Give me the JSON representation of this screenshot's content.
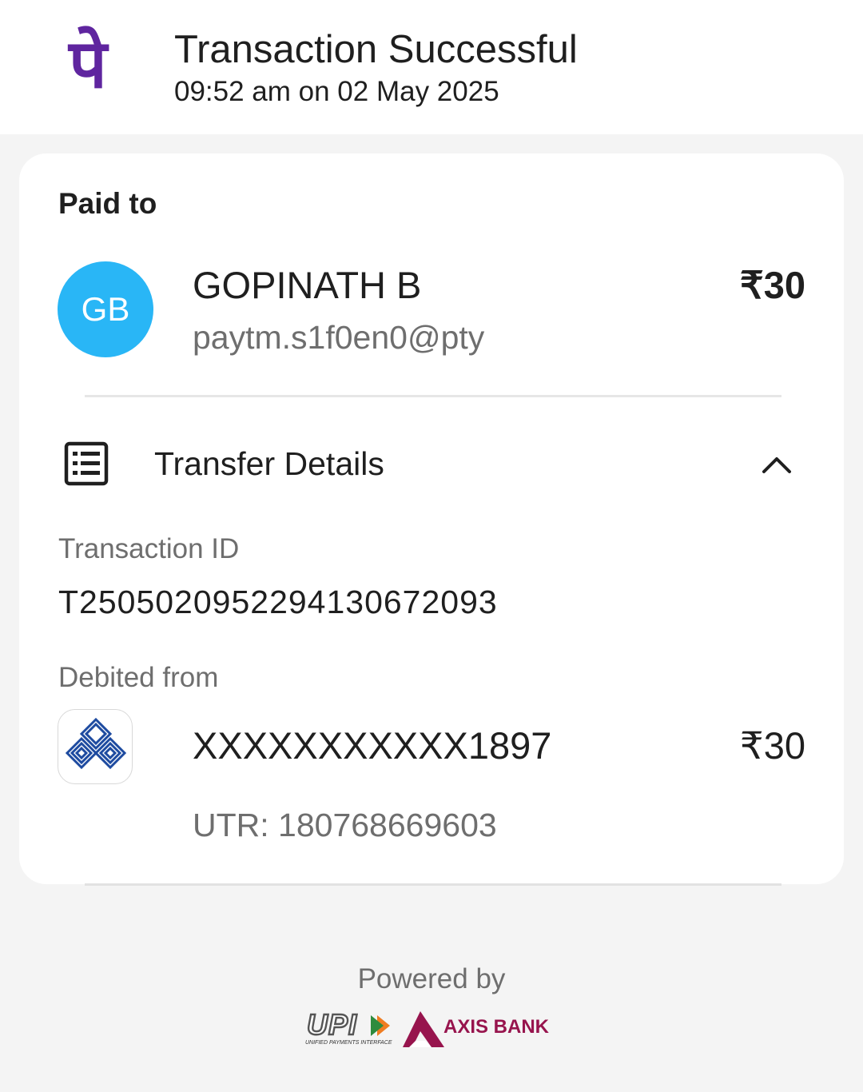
{
  "header": {
    "logo_glyph": "पे",
    "title": "Transaction Successful",
    "subtitle": "09:52 am on 02 May 2025"
  },
  "payment": {
    "section_label": "Paid to",
    "avatar_initials": "GB",
    "avatar_color": "#29b6f6",
    "payee_name": "GOPINATH B",
    "payee_vpa": "paytm.s1f0en0@pty",
    "amount": "₹30"
  },
  "transfer_details": {
    "title": "Transfer Details",
    "transaction_id_label": "Transaction ID",
    "transaction_id": "T2505020952294130672093",
    "debited_from_label": "Debited from",
    "account_number": "XXXXXXXXXXX1897",
    "account_amount": "₹30",
    "utr": "UTR: 180768669603"
  },
  "footer": {
    "powered_by": "Powered by",
    "upi_logo_text": "UPI",
    "upi_tagline": "UNIFIED PAYMENTS INTERFACE",
    "bank_partner": "AXIS BANK"
  },
  "colors": {
    "brand_purple": "#5f259f",
    "axis_maroon": "#97144d",
    "bank_blue": "#1e4ba0"
  }
}
